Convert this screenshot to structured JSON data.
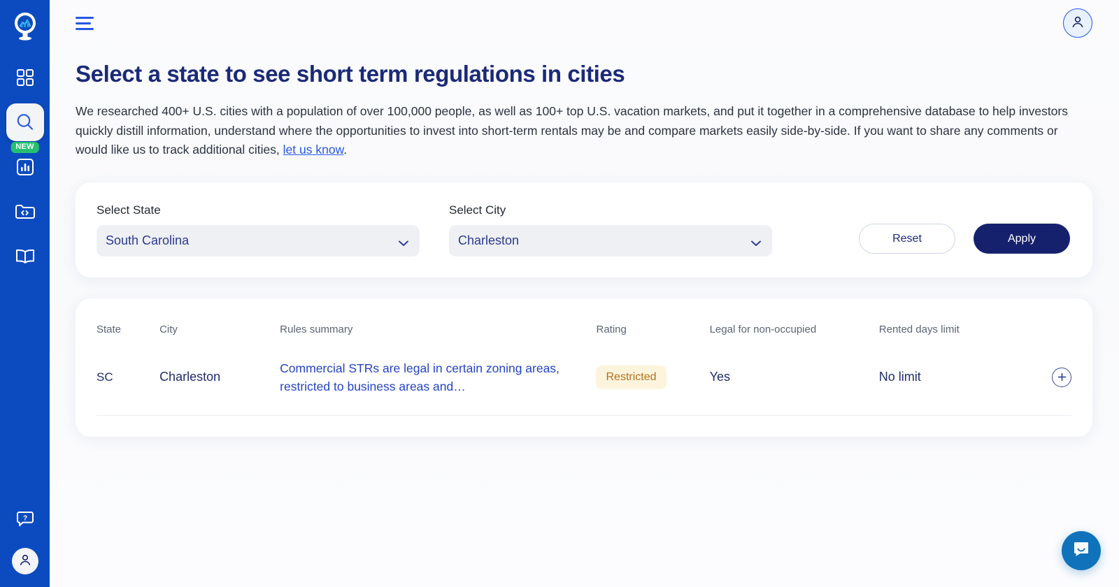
{
  "sidebar": {
    "logo_icon": "map-pin-chart-logo",
    "items": [
      {
        "icon": "grid-dashboard-icon",
        "name": "dashboard",
        "active": false,
        "badge": null
      },
      {
        "icon": "search-icon",
        "name": "search",
        "active": true,
        "badge": null
      },
      {
        "icon": "bar-chart-icon",
        "name": "analytics",
        "active": false,
        "badge": "NEW"
      },
      {
        "icon": "folder-code-icon",
        "name": "api",
        "active": false,
        "badge": null
      },
      {
        "icon": "book-open-icon",
        "name": "docs",
        "active": false,
        "badge": null
      }
    ],
    "bottom_items": [
      {
        "icon": "help-chat-icon",
        "name": "help"
      },
      {
        "icon": "user-icon",
        "name": "account"
      }
    ]
  },
  "topbar": {
    "menu_icon": "hamburger-menu-icon",
    "avatar_icon": "user-avatar-icon"
  },
  "page": {
    "title": "Select a state to see short term regulations in cities",
    "description_part1": "We researched 400+ U.S. cities with a population of over 100,000 people, as well as 100+ top U.S. vacation markets, and put it together in a comprehensive database to help investors quickly distill information, understand where the opportunities to invest into short-term rentals may be and compare markets easily side-by-side. If you want to share any comments or would like us to track additional cities, ",
    "description_link": "let us know",
    "description_part2": "."
  },
  "filters": {
    "state_label": "Select State",
    "state_value": "South Carolina",
    "city_label": "Select City",
    "city_value": "Charleston",
    "reset_label": "Reset",
    "apply_label": "Apply"
  },
  "table": {
    "headers": {
      "state": "State",
      "city": "City",
      "rules": "Rules summary",
      "rating": "Rating",
      "legal": "Legal for non-occupied",
      "days": "Rented days limit"
    },
    "rows": [
      {
        "state": "SC",
        "city": "Charleston",
        "rules": "Commercial STRs are legal in certain zoning areas, restricted to business areas and…",
        "rating": "Restricted",
        "legal": "Yes",
        "days": "No limit",
        "expand_icon": "plus-circle-icon"
      }
    ]
  },
  "chat": {
    "icon": "chat-bubble-icon"
  },
  "colors": {
    "sidebar_blue": "#0c4bbf",
    "accent_blue": "#2558e6",
    "navy": "#16216e",
    "heading_navy": "#1b2a78",
    "badge_green": "#25c16f",
    "badge_restricted_bg": "#fdf4dd",
    "badge_restricted_text": "#b4701c",
    "chat_blue": "#1072ba"
  }
}
